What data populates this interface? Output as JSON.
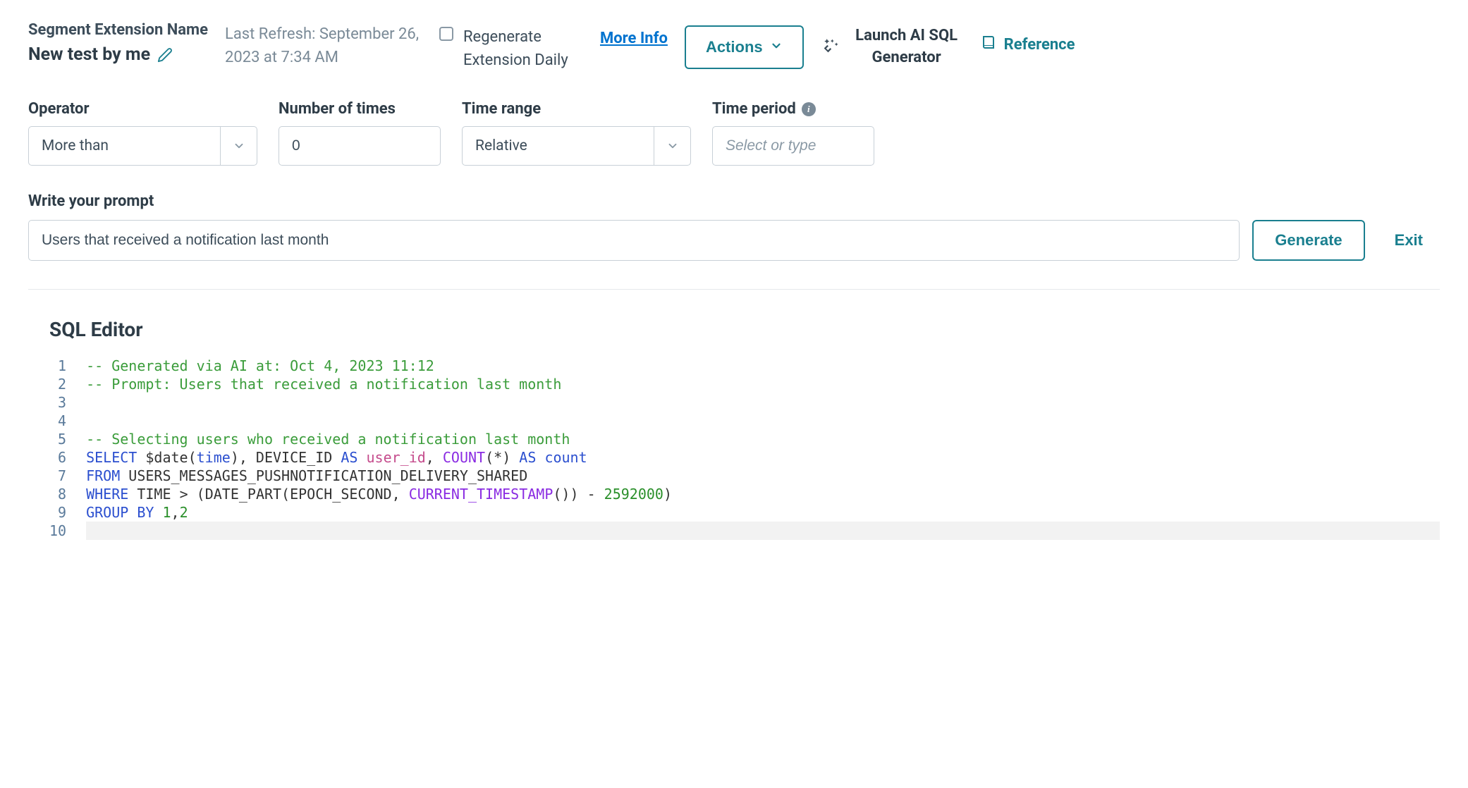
{
  "header": {
    "title_label": "Segment Extension Name",
    "title_name": "New test by me",
    "last_refresh": "Last Refresh: September 26, 2023 at 7:34 AM",
    "regenerate_label": "Regenerate Extension Daily",
    "more_info": "More Info",
    "actions_label": "Actions",
    "ai_label": "Launch AI SQL Generator",
    "reference_label": "Reference"
  },
  "filters": {
    "operator": {
      "label": "Operator",
      "value": "More than"
    },
    "number_of_times": {
      "label": "Number of times",
      "value": "0"
    },
    "time_range": {
      "label": "Time range",
      "value": "Relative"
    },
    "time_period": {
      "label": "Time period",
      "placeholder": "Select or type"
    }
  },
  "prompt": {
    "label": "Write your prompt",
    "value": "Users that received a notification last month",
    "generate_label": "Generate",
    "exit_label": "Exit"
  },
  "editor": {
    "title": "SQL Editor",
    "lines": [
      {
        "n": 1,
        "tokens": [
          [
            "comment",
            "-- Generated via AI at: Oct 4, 2023 11:12"
          ]
        ]
      },
      {
        "n": 2,
        "tokens": [
          [
            "comment",
            "-- Prompt: Users that received a notification last month"
          ]
        ]
      },
      {
        "n": 3,
        "tokens": []
      },
      {
        "n": 4,
        "tokens": []
      },
      {
        "n": 5,
        "tokens": [
          [
            "comment",
            "-- Selecting users who received a notification last month"
          ]
        ]
      },
      {
        "n": 6,
        "tokens": [
          [
            "kw",
            "SELECT"
          ],
          [
            "plain",
            " $date("
          ],
          [
            "kw",
            "time"
          ],
          [
            "plain",
            "), DEVICE_ID "
          ],
          [
            "kw",
            "AS"
          ],
          [
            "plain",
            " "
          ],
          [
            "name",
            "user_id"
          ],
          [
            "plain",
            ", "
          ],
          [
            "func",
            "COUNT"
          ],
          [
            "plain",
            "("
          ],
          [
            "op",
            "*"
          ],
          [
            "plain",
            ") "
          ],
          [
            "kw",
            "AS"
          ],
          [
            "plain",
            " "
          ],
          [
            "kw",
            "count"
          ]
        ]
      },
      {
        "n": 7,
        "tokens": [
          [
            "kw",
            "FROM"
          ],
          [
            "plain",
            " USERS_MESSAGES_PUSHNOTIFICATION_DELIVERY_SHARED"
          ]
        ]
      },
      {
        "n": 8,
        "tokens": [
          [
            "kw",
            "WHERE"
          ],
          [
            "plain",
            " TIME "
          ],
          [
            "op",
            ">"
          ],
          [
            "plain",
            " (DATE_PART(EPOCH_SECOND, "
          ],
          [
            "func",
            "CURRENT_TIMESTAMP"
          ],
          [
            "plain",
            "()) "
          ],
          [
            "op",
            "-"
          ],
          [
            "plain",
            " "
          ],
          [
            "num",
            "2592000"
          ],
          [
            "plain",
            ")"
          ]
        ]
      },
      {
        "n": 9,
        "tokens": [
          [
            "kw",
            "GROUP"
          ],
          [
            "plain",
            " "
          ],
          [
            "kw",
            "BY"
          ],
          [
            "plain",
            " "
          ],
          [
            "num",
            "1"
          ],
          [
            "plain",
            ","
          ],
          [
            "num",
            "2"
          ]
        ]
      },
      {
        "n": 10,
        "tokens": []
      }
    ]
  }
}
